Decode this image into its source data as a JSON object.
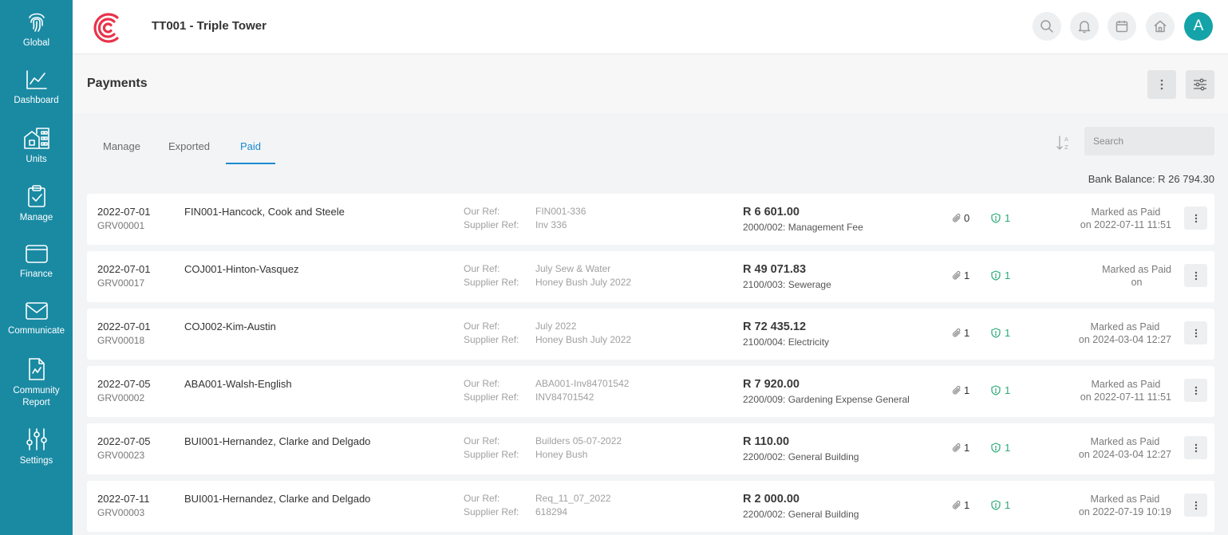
{
  "sidebar": {
    "items": [
      {
        "label": "Global"
      },
      {
        "label": "Dashboard"
      },
      {
        "label": "Units"
      },
      {
        "label": "Manage"
      },
      {
        "label": "Finance"
      },
      {
        "label": "Communicate"
      },
      {
        "label": "Community\nReport"
      },
      {
        "label": "Settings"
      }
    ]
  },
  "topbar": {
    "property_title": "TT001 - Triple Tower",
    "avatar_letter": "A"
  },
  "header": {
    "page_title": "Payments"
  },
  "tabs": [
    {
      "label": "Manage"
    },
    {
      "label": "Exported"
    },
    {
      "label": "Paid",
      "active": true
    }
  ],
  "search": {
    "placeholder": "Search"
  },
  "bank_balance": "Bank Balance: R 26 794.30",
  "colors": {
    "sidebar": "#1a8aa3",
    "accent": "#1a8ad0",
    "avatar": "#14a3a8",
    "shield_green": "#2aa876",
    "logo_red": "#e8334a"
  },
  "payments": {
    "our_ref_label": "Our Ref:",
    "supplier_ref_label": "Supplier Ref:",
    "rows": [
      {
        "date": "2022-07-01",
        "grv": "GRV00001",
        "supplier": "FIN001-Hancock, Cook and Steele",
        "our_ref": "FIN001-336",
        "supplier_ref": "Inv 336",
        "amount": "R 6 601.00",
        "account": "2000/002: Management Fee",
        "attachments": "0",
        "approvals": "1",
        "status_line1": "Marked as Paid",
        "status_line2": "on 2022-07-11 11:51"
      },
      {
        "date": "2022-07-01",
        "grv": "GRV00017",
        "supplier": "COJ001-Hinton-Vasquez",
        "our_ref": "July Sew & Water",
        "supplier_ref": "Honey Bush July 2022",
        "amount": "R 49 071.83",
        "account": "2100/003: Sewerage",
        "attachments": "1",
        "approvals": "1",
        "status_line1": "Marked as Paid",
        "status_line2": "on"
      },
      {
        "date": "2022-07-01",
        "grv": "GRV00018",
        "supplier": "COJ002-Kim-Austin",
        "our_ref": "July 2022",
        "supplier_ref": "Honey Bush July 2022",
        "amount": "R 72 435.12",
        "account": "2100/004: Electricity",
        "attachments": "1",
        "approvals": "1",
        "status_line1": "Marked as Paid",
        "status_line2": "on 2024-03-04 12:27"
      },
      {
        "date": "2022-07-05",
        "grv": "GRV00002",
        "supplier": "ABA001-Walsh-English",
        "our_ref": "ABA001-Inv84701542",
        "supplier_ref": "INV84701542",
        "amount": "R 7 920.00",
        "account": "2200/009: Gardening Expense General",
        "attachments": "1",
        "approvals": "1",
        "status_line1": "Marked as Paid",
        "status_line2": "on 2022-07-11 11:51"
      },
      {
        "date": "2022-07-05",
        "grv": "GRV00023",
        "supplier": "BUI001-Hernandez, Clarke and Delgado",
        "our_ref": "Builders 05-07-2022",
        "supplier_ref": "Honey Bush",
        "amount": "R 110.00",
        "account": "2200/002: General Building",
        "attachments": "1",
        "approvals": "1",
        "status_line1": "Marked as Paid",
        "status_line2": "on 2024-03-04 12:27"
      },
      {
        "date": "2022-07-11",
        "grv": "GRV00003",
        "supplier": "BUI001-Hernandez, Clarke and Delgado",
        "our_ref": "Req_11_07_2022",
        "supplier_ref": "618294",
        "amount": "R 2 000.00",
        "account": "2200/002: General Building",
        "attachments": "1",
        "approvals": "1",
        "status_line1": "Marked as Paid",
        "status_line2": "on 2022-07-19 10:19"
      }
    ]
  }
}
